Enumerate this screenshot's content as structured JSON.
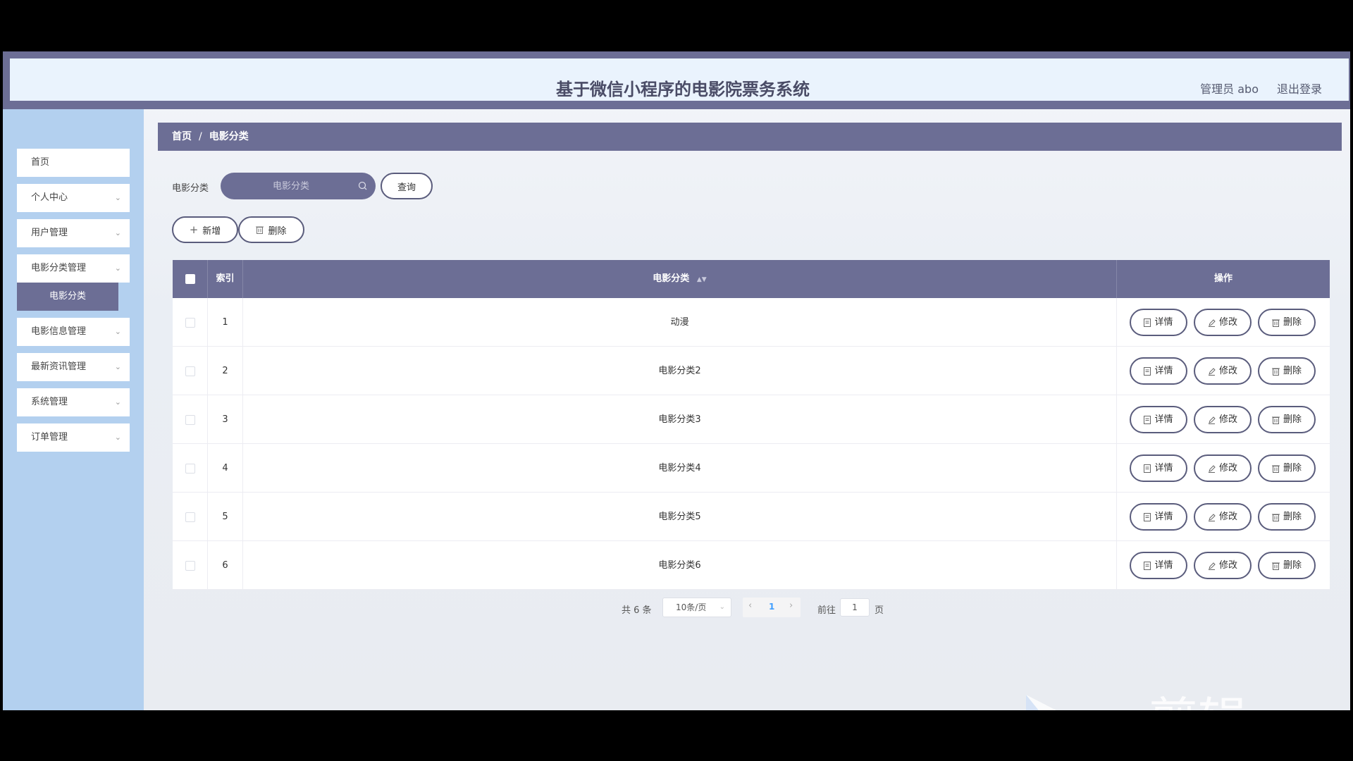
{
  "header": {
    "title": "基于微信小程序的电影院票务系统",
    "admin": "管理员 abo",
    "logout": "退出登录"
  },
  "sidebar": {
    "items": [
      {
        "label": "首页"
      },
      {
        "label": "个人中心"
      },
      {
        "label": "用户管理"
      },
      {
        "label": "电影分类管理"
      },
      {
        "label": "电影信息管理"
      },
      {
        "label": "最新资讯管理"
      },
      {
        "label": "系统管理"
      },
      {
        "label": "订单管理"
      }
    ],
    "submenu_active": "电影分类"
  },
  "breadcrumb": {
    "home": "首页",
    "sep": "/",
    "current": "电影分类"
  },
  "search": {
    "label": "电影分类",
    "placeholder": "电影分类",
    "query_button": "查询"
  },
  "toolbar": {
    "add_label": "新增",
    "delete_label": "删除"
  },
  "table": {
    "headers": {
      "index": "索引",
      "category": "电影分类",
      "actions": "操作"
    },
    "rows": [
      {
        "index": "1",
        "category": "动漫"
      },
      {
        "index": "2",
        "category": "电影分类2"
      },
      {
        "index": "3",
        "category": "电影分类3"
      },
      {
        "index": "4",
        "category": "电影分类4"
      },
      {
        "index": "5",
        "category": "电影分类5"
      },
      {
        "index": "6",
        "category": "电影分类6"
      }
    ],
    "actions": {
      "detail": "详情",
      "edit": "修改",
      "delete": "删除"
    }
  },
  "pagination": {
    "total": "共 6 条",
    "page_size": "10条/页",
    "current_page": "1",
    "goto_label": "前往",
    "goto_value": "1",
    "page_suffix": "页"
  },
  "watermark": {
    "text": "ev剪辑"
  },
  "colors": {
    "primary": "#6c6e95",
    "sidebar": "#b3d0ef",
    "header_bg": "#eaf3fd"
  }
}
